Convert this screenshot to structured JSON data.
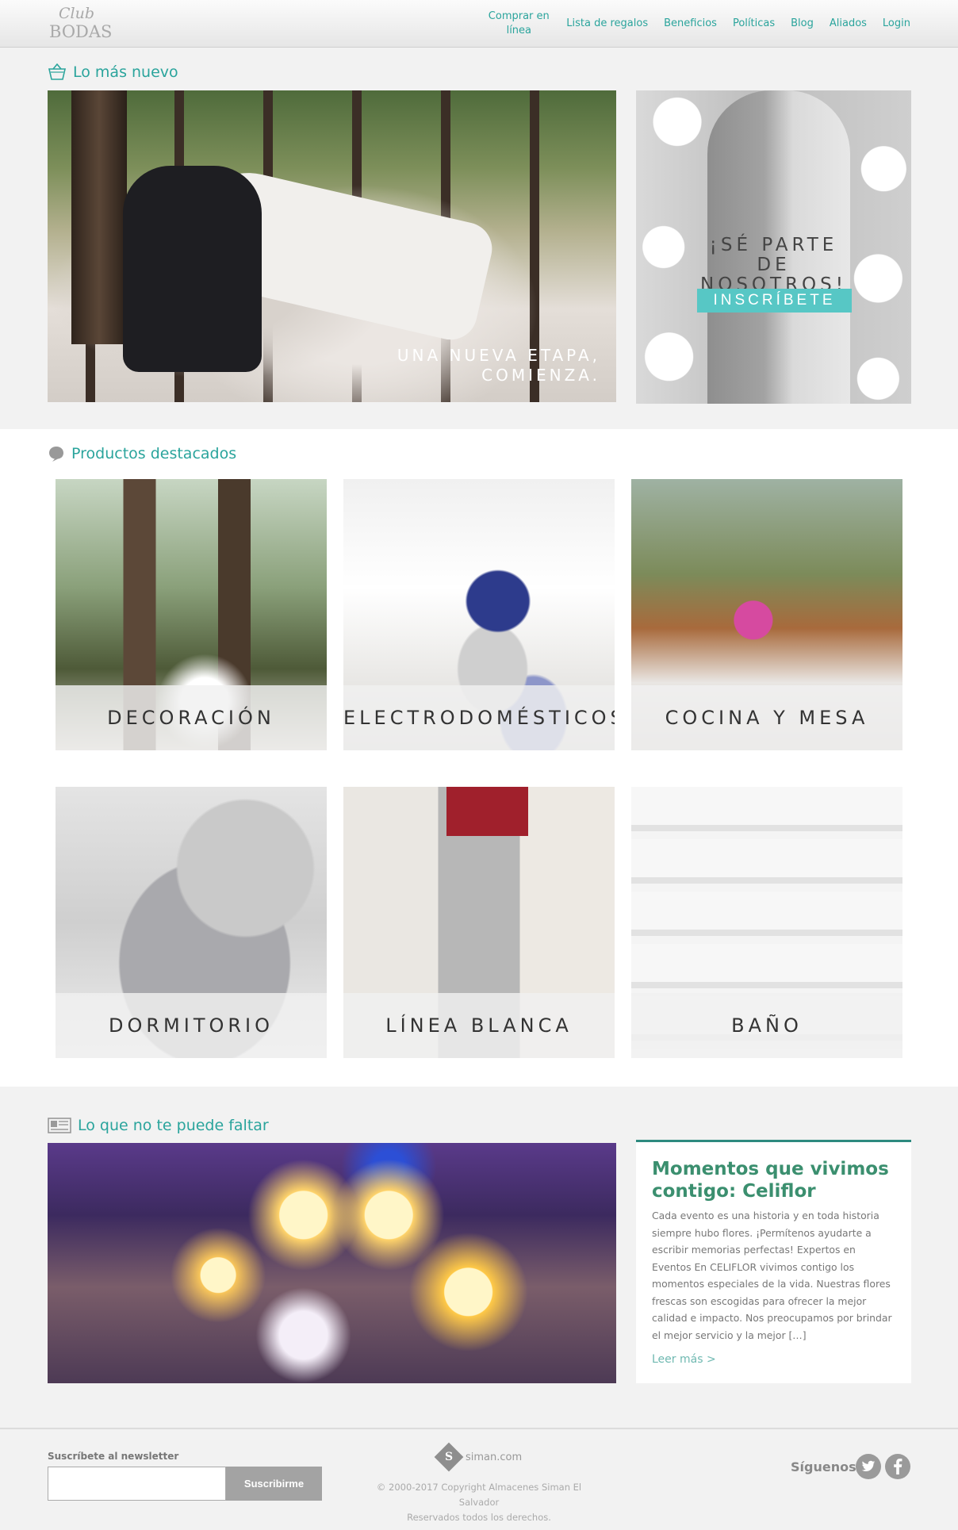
{
  "header": {
    "logo": {
      "line1": "Club",
      "line2": "BODAS"
    },
    "nav": [
      {
        "label": "Comprar en línea"
      },
      {
        "label": "Lista de regalos"
      },
      {
        "label": "Beneficios"
      },
      {
        "label": "Políticas"
      },
      {
        "label": "Blog"
      },
      {
        "label": "Aliados"
      },
      {
        "label": "Login"
      }
    ]
  },
  "section_new": {
    "title": "Lo más nuevo",
    "icon": "basket-icon",
    "hero_caption": "UNA NUEVA ETAPA, COMIENZA.",
    "join_text": "¡SÉ PARTE DE NOSOTROS!",
    "join_button": "INSCRÍBETE"
  },
  "section_products": {
    "title": "Productos destacados",
    "icon": "speech-bubble-icon",
    "items": [
      {
        "label": "DECORACIÓN"
      },
      {
        "label": "ELECTRODOMÉSTICOS"
      },
      {
        "label": "COCINA Y MESA"
      },
      {
        "label": "DORMITORIO"
      },
      {
        "label": "LÍNEA BLANCA"
      },
      {
        "label": "BAÑO"
      }
    ]
  },
  "section_musthave": {
    "title": "Lo que no te puede faltar",
    "icon": "newspaper-icon",
    "article": {
      "title": "Momentos que vivimos contigo: Celiflor",
      "body": "Cada evento es una historia y en toda historia siempre hubo flores. ¡Permítenos ayudarte a escribir memorias perfectas!     Expertos en Eventos En CELIFLOR vivimos contigo los momentos especiales de la vida. Nuestras flores frescas son escogidas para ofrecer la mejor calidad e impacto. Nos preocupamos por brindar el mejor servicio y la mejor […]",
      "read_more": "Leer más >"
    }
  },
  "footer": {
    "newsletter_label": "Suscríbete al newsletter",
    "newsletter_placeholder": "",
    "subscribe_button": "Suscribirme",
    "brand": "siman.com",
    "brand_mark": "S",
    "copyright_line1": "© 2000-2017 Copyright Almacenes Siman El Salvador",
    "copyright_line2": "Reservados todos los derechos.",
    "follow_label": "Síguenos",
    "social": [
      {
        "icon": "twitter-icon"
      },
      {
        "icon": "facebook-icon"
      }
    ]
  },
  "colors": {
    "accent": "#2aa49c",
    "button_teal": "#57c7c5",
    "article_title": "#3b8f6f"
  }
}
